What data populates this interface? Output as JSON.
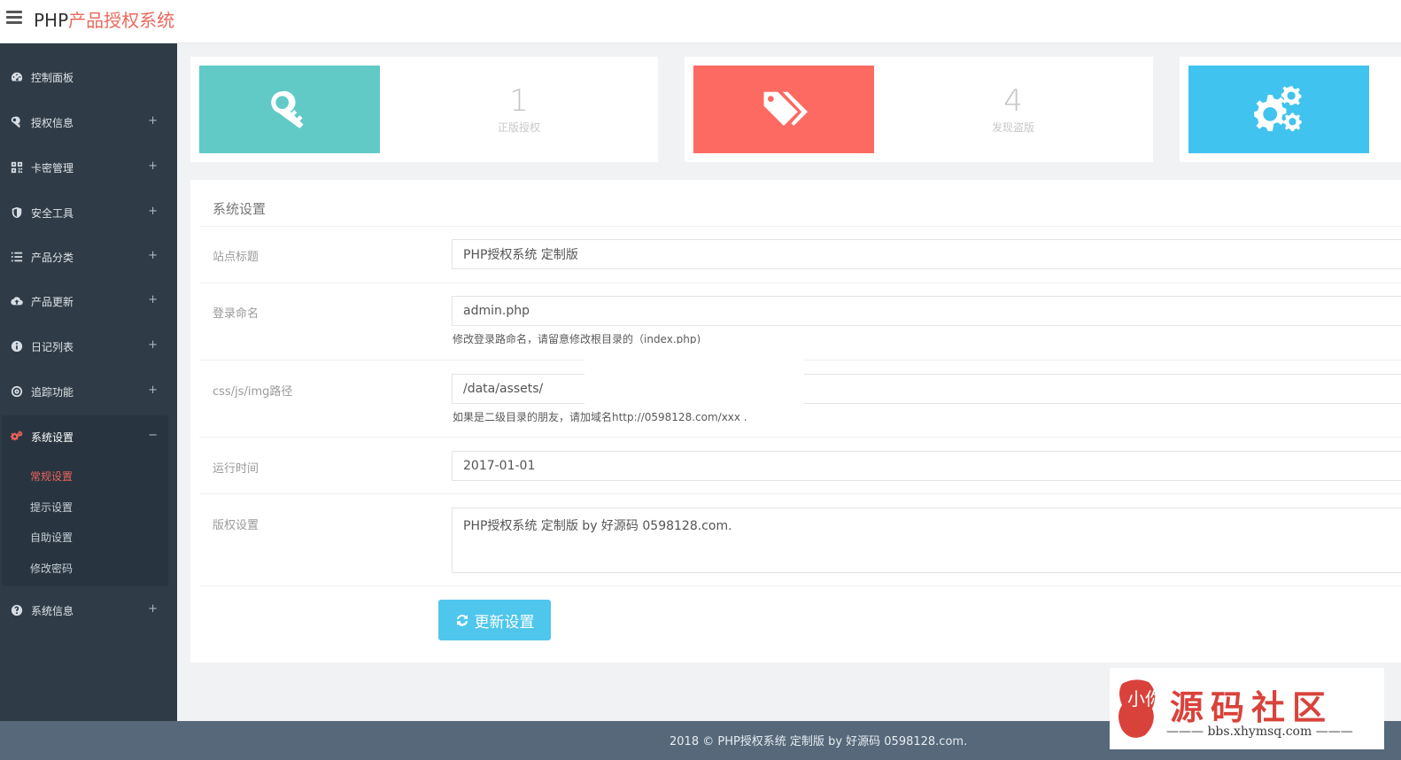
{
  "header": {
    "brand_prefix": "PHP",
    "brand_title": "产品授权系统"
  },
  "sidebar": {
    "items": [
      {
        "label": "控制面板",
        "icon": "dashboard-icon"
      },
      {
        "label": "授权信息",
        "icon": "key-icon",
        "toggle": "+"
      },
      {
        "label": "卡密管理",
        "icon": "qrcode-icon",
        "toggle": "+"
      },
      {
        "label": "安全工具",
        "icon": "shield-icon",
        "toggle": "+"
      },
      {
        "label": "产品分类",
        "icon": "list-icon",
        "toggle": "+"
      },
      {
        "label": "产品更新",
        "icon": "cloud-upload-icon",
        "toggle": "+"
      },
      {
        "label": "日记列表",
        "icon": "info-icon",
        "toggle": "+"
      },
      {
        "label": "追踪功能",
        "icon": "target-icon",
        "toggle": "+"
      },
      {
        "label": "系统设置",
        "icon": "gears-icon",
        "toggle": "−"
      },
      {
        "label": "系统信息",
        "icon": "question-icon",
        "toggle": "+"
      }
    ],
    "sub_items": [
      "常规设置",
      "提示设置",
      "自助设置",
      "修改密码"
    ],
    "active_color": "#f0625c"
  },
  "cards": [
    {
      "value": "1",
      "label": "正版授权",
      "icon": "key-icon",
      "color": "#62cac6"
    },
    {
      "value": "4",
      "label": "发现盗版",
      "icon": "tags-icon",
      "color": "#fd6a62"
    },
    {
      "icon": "gears-icon",
      "color": "#40c3ee"
    }
  ],
  "settings": {
    "title": "系统设置",
    "site_title_label": "站点标题",
    "site_title_value": "PHP授权系统 定制版",
    "login_label": "登录命名",
    "login_value": "admin.php",
    "login_help": "修改登录路命名，请留意修改根目录的（index.php)",
    "assets_label": "css/js/img路径",
    "assets_value": "/data/assets/",
    "assets_help": "如果是二级目录的朋友，请加域名http://0598128.com/xxx .",
    "runtime_label": "运行时间",
    "runtime_value": "2017-01-01",
    "copyright_label": "版权设置",
    "copyright_value": "PHP授权系统 定制版 by 好源码 0598128.com.",
    "update_button": "更新设置"
  },
  "footer": {
    "text": "2018 © PHP授权系统 定制版 by 好源码 0598128.com."
  },
  "watermark": {
    "title": "源码社区",
    "url": "——— bbs.xhymsq.com ———",
    "seal": "小你"
  }
}
